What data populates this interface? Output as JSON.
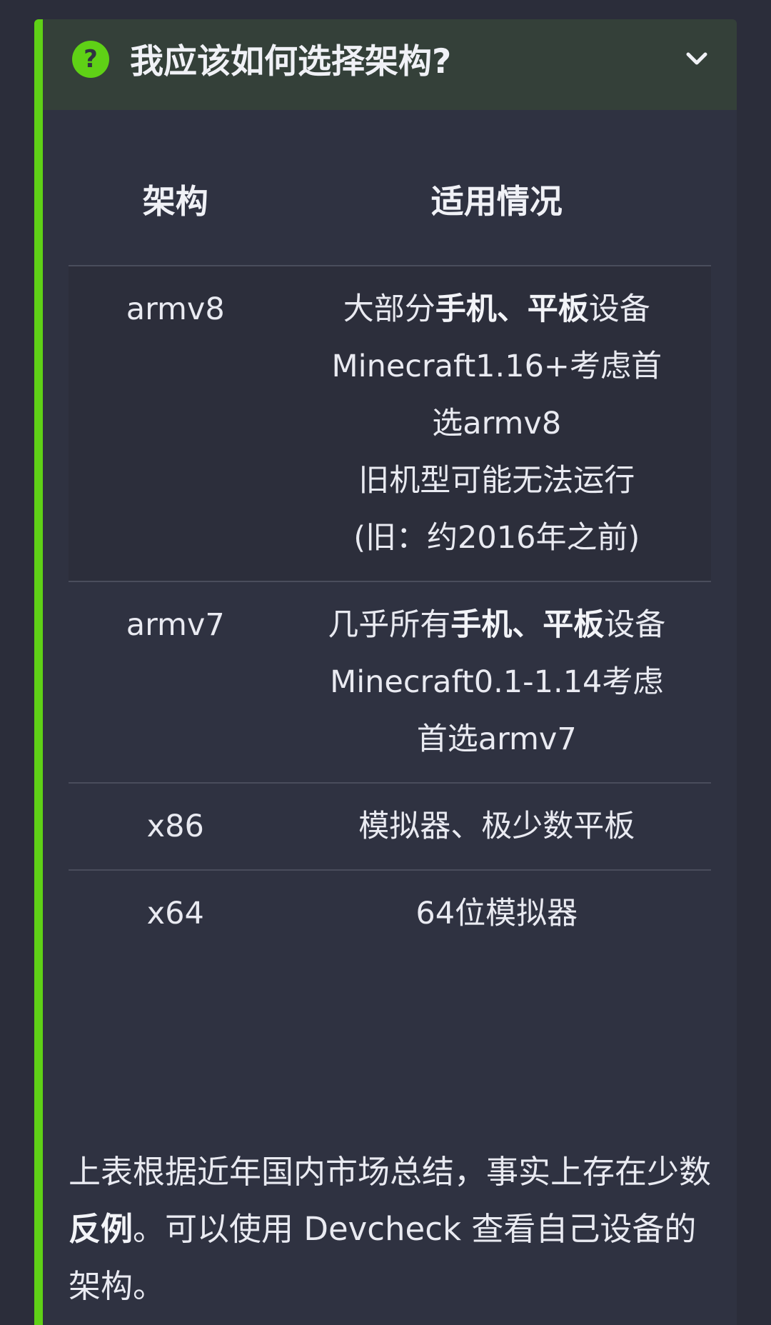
{
  "faq": {
    "title": "我应该如何选择架构?",
    "icon": "question-circle-icon",
    "toggle_icon": "chevron-down-icon",
    "accent_color": "#5fd116"
  },
  "table": {
    "headers": [
      "架构",
      "适用情况"
    ],
    "rows": [
      {
        "arch": "armv8",
        "lines": [
          [
            {
              "t": "大部分"
            },
            {
              "t": "手机、平板",
              "b": true
            },
            {
              "t": "设备"
            }
          ],
          [
            {
              "t": "Minecraft1.16+考虑首选armv8"
            }
          ],
          [
            {
              "t": "旧机型可能无法运行"
            }
          ],
          [
            {
              "t": "(旧：约2016年之前)"
            }
          ]
        ]
      },
      {
        "arch": "armv7",
        "lines": [
          [
            {
              "t": "几乎所有"
            },
            {
              "t": "手机、平板",
              "b": true
            },
            {
              "t": "设备"
            }
          ],
          [
            {
              "t": "Minecraft0.1-1.14考虑首选armv7"
            }
          ]
        ]
      },
      {
        "arch": "x86",
        "lines": [
          [
            {
              "t": "模拟器、极少数平板"
            }
          ]
        ]
      },
      {
        "arch": "x64",
        "lines": [
          [
            {
              "t": "64位模拟器"
            }
          ]
        ]
      }
    ]
  },
  "summary": [
    {
      "t": "上表根据近年国内市场总结，事实上存在少数"
    },
    {
      "t": "反例",
      "b": true
    },
    {
      "t": "。可以使用 Devcheck 查看自己设备的架构。"
    }
  ]
}
